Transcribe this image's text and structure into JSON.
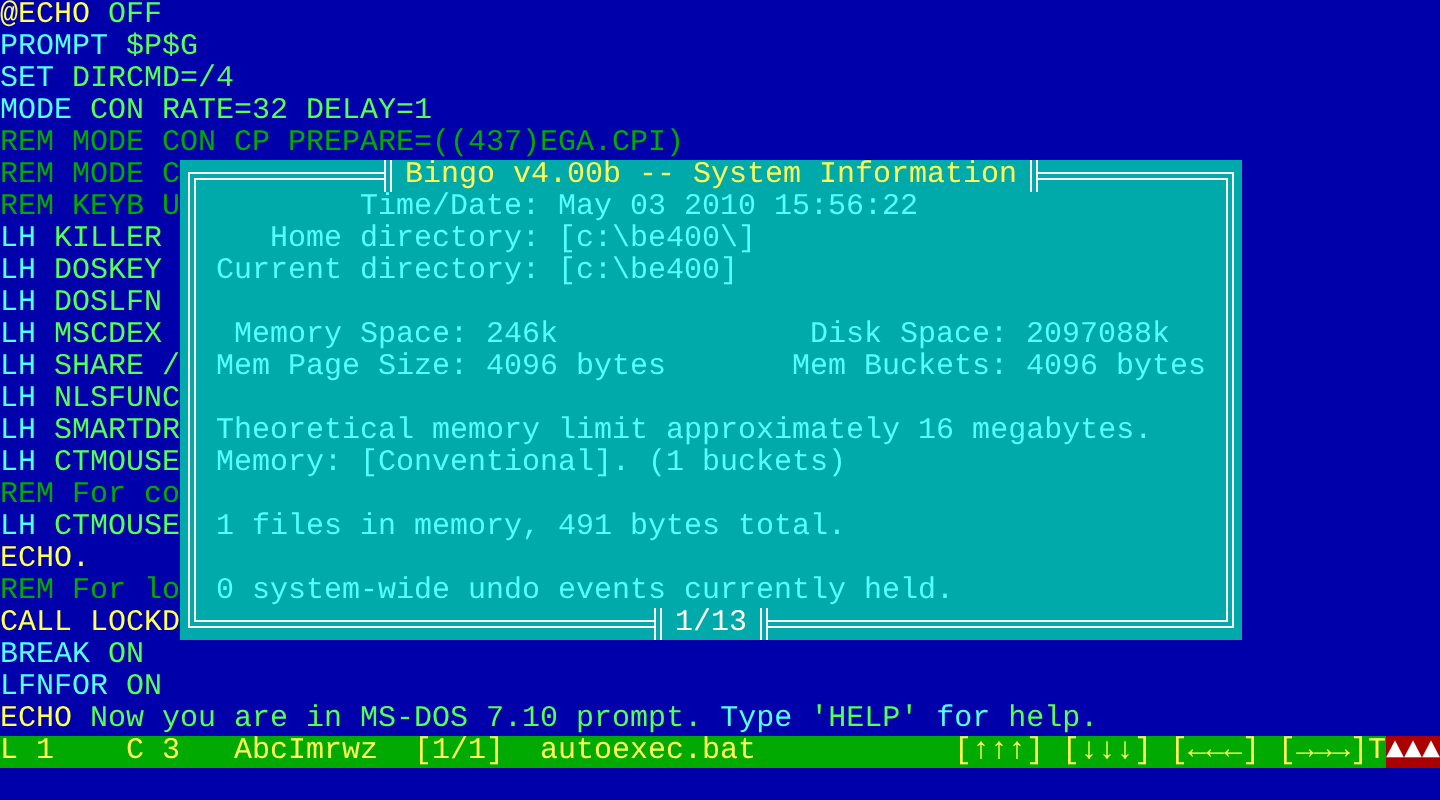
{
  "editor": {
    "lines": [
      [
        {
          "text": "@ECHO",
          "color": "#ffff55"
        },
        {
          "text": "OFF",
          "color": "#55ff55"
        }
      ],
      [
        {
          "text": "PROMPT",
          "color": "#55ffff"
        },
        {
          "text": "$P$G",
          "color": "#55ff55"
        }
      ],
      [
        {
          "text": "SET",
          "color": "#55ffff"
        },
        {
          "text": "DIRCMD=/4",
          "color": "#55ff55"
        }
      ],
      [
        {
          "text": "MODE",
          "color": "#55ffff"
        },
        {
          "text": "CON RATE=32 DELAY=1",
          "color": "#55ff55"
        }
      ],
      [
        {
          "text": "REM MODE CON CP PREPARE=((437)EGA.CPI)",
          "color": "#00aa00"
        }
      ],
      [
        {
          "text": "REM MODE C",
          "color": "#00aa00"
        }
      ],
      [
        {
          "text": "REM KEYB U",
          "color": "#00aa00"
        }
      ],
      [
        {
          "text": "LH",
          "color": "#55ffff"
        },
        {
          "text": "KILLER",
          "color": "#55ff55"
        }
      ],
      [
        {
          "text": "LH",
          "color": "#55ffff"
        },
        {
          "text": "DOSKEY",
          "color": "#55ff55"
        }
      ],
      [
        {
          "text": "LH",
          "color": "#55ffff"
        },
        {
          "text": "DOSLFN",
          "color": "#55ff55"
        }
      ],
      [
        {
          "text": "LH",
          "color": "#55ffff"
        },
        {
          "text": "MSCDEX",
          "color": "#55ff55"
        }
      ],
      [
        {
          "text": "LH",
          "color": "#55ffff"
        },
        {
          "text": "SHARE /",
          "color": "#55ff55"
        }
      ],
      [
        {
          "text": "LH",
          "color": "#55ffff"
        },
        {
          "text": "NLSFUNC",
          "color": "#55ff55"
        }
      ],
      [
        {
          "text": "LH",
          "color": "#55ffff"
        },
        {
          "text": "SMARTDR",
          "color": "#55ff55"
        }
      ],
      [
        {
          "text": "LH",
          "color": "#55ffff"
        },
        {
          "text": "CTMOUSE",
          "color": "#55ff55"
        }
      ],
      [
        {
          "text": "REM For co",
          "color": "#00aa00"
        }
      ],
      [
        {
          "text": "LH",
          "color": "#55ffff"
        },
        {
          "text": "CTMOUSE",
          "color": "#55ff55"
        }
      ],
      [
        {
          "text": "ECHO.",
          "color": "#ffff55"
        }
      ],
      [
        {
          "text": "REM For lo",
          "color": "#00aa00"
        }
      ],
      [
        {
          "text": "CALL LOCKD",
          "color": "#ffff55"
        }
      ],
      [
        {
          "text": "BREAK",
          "color": "#55ffff"
        },
        {
          "text": "ON",
          "color": "#55ff55"
        }
      ],
      [
        {
          "text": "LFNFOR",
          "color": "#55ffff"
        },
        {
          "text": "ON",
          "color": "#55ff55"
        }
      ],
      [
        {
          "text": "ECHO",
          "color": "#ffff55"
        },
        {
          "text": "Now you are in MS-DOS 7.10 prompt.",
          "color": "#55ff55"
        },
        {
          "text": "Type",
          "color": "#55ffff"
        },
        {
          "text": "'HELP'",
          "color": "#55ff55"
        },
        {
          "text": "for",
          "color": "#55ffff"
        },
        {
          "text": "help.",
          "color": "#55ff55"
        }
      ]
    ]
  },
  "dialog": {
    "title": "Bingo v4.00b -- System Information",
    "page": "1/13",
    "rows": [
      [
        "Time/Date: May 03 2010 15:56:22"
      ],
      [
        "Home directory: [c:\\be400\\]"
      ],
      [
        "Current directory: [c:\\be400]"
      ],
      [],
      [
        "Memory Space: 246k",
        "Disk Space: 2097088k"
      ],
      [
        "Mem Page Size: 4096 bytes",
        "Mem Buckets: 4096 bytes"
      ],
      [],
      [
        "Theoretical memory limit approximately 16 megabytes."
      ],
      [
        "Memory: [Conventional]. (1 buckets)"
      ],
      [],
      [
        "1 files in memory, 491 bytes total."
      ],
      [],
      [
        "0 system-wide undo events currently held."
      ]
    ]
  },
  "status_bar": {
    "items": [
      "L 1",
      "C 3",
      "AbcImrwz",
      "[1/1]",
      "autoexec.bat",
      "[↑↑↑]",
      "[↓↓↓]",
      "[←←←]",
      "[→→→]T"
    ],
    "alert": "▲▲▲"
  }
}
